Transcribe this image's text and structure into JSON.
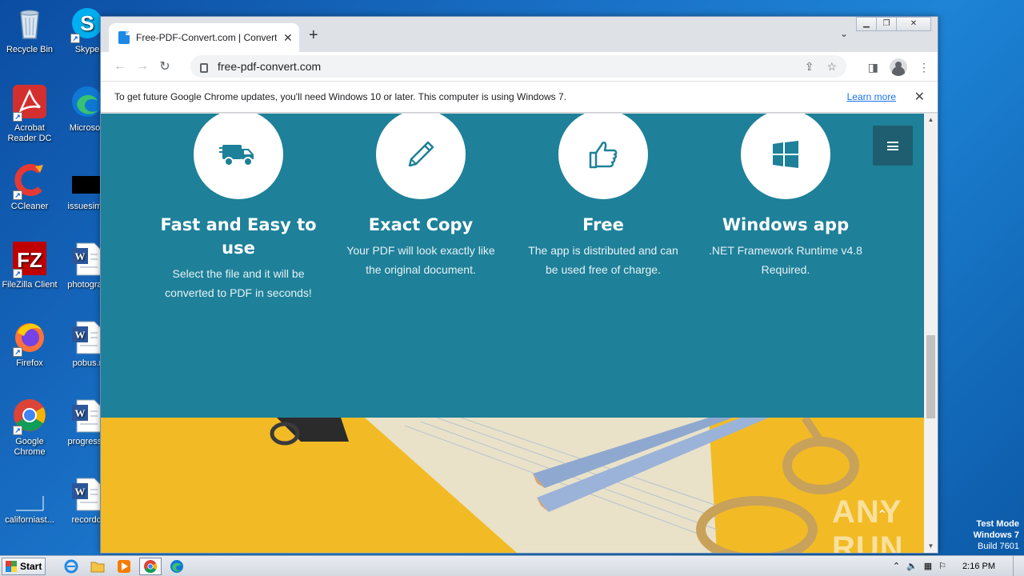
{
  "desktop": {
    "icons": [
      {
        "label": "Recycle Bin",
        "icon": "recycle-bin-icon"
      },
      {
        "label": "Skype",
        "icon": "skype-icon"
      },
      {
        "label": "Acrobat Reader DC",
        "icon": "acrobat-icon"
      },
      {
        "label": "Microsoft",
        "icon": "edge-icon"
      },
      {
        "label": "CCleaner",
        "icon": "ccleaner-icon"
      },
      {
        "label": "issuesimp",
        "icon": "file-icon"
      },
      {
        "label": "FileZilla Client",
        "icon": "filezilla-icon"
      },
      {
        "label": "photograp",
        "icon": "word-doc-icon"
      },
      {
        "label": "Firefox",
        "icon": "firefox-icon"
      },
      {
        "label": "pobus.r",
        "icon": "word-doc-icon"
      },
      {
        "label": "Google Chrome",
        "icon": "chrome-icon"
      },
      {
        "label": "progresso",
        "icon": "word-doc-icon"
      },
      {
        "label": "californiast...",
        "icon": "file-icon"
      },
      {
        "label": "recordcl",
        "icon": "word-doc-icon"
      }
    ],
    "test_mode": {
      "line1": "Test Mode",
      "line2": "Windows 7",
      "line3": "Build 7601"
    }
  },
  "browser": {
    "tab_title": "Free-PDF-Convert.com | Convert html",
    "url": "free-pdf-convert.com",
    "infobar": {
      "message": "To get future Google Chrome updates, you'll need Windows 10 or later. This computer is using Windows 7.",
      "link": "Learn more"
    }
  },
  "page": {
    "features": [
      {
        "icon": "truck-icon",
        "title": "Fast and Easy to use",
        "desc": "Select the file and it will be converted to PDF in seconds!"
      },
      {
        "icon": "pencil-icon",
        "title": "Exact Copy",
        "desc": "Your PDF will look exactly like the original document."
      },
      {
        "icon": "thumbs-up-icon",
        "title": "Free",
        "desc": "The app is distributed and can be used free of charge."
      },
      {
        "icon": "windows-icon",
        "title": "Windows app",
        "desc": ".NET Framework Runtime v4.8 Required."
      }
    ],
    "watermark": "ANY RUN",
    "colors": {
      "teal": "#1e8099",
      "menu": "#1f5e70",
      "photo_bg": "#f2bb25"
    }
  },
  "taskbar": {
    "start_label": "Start",
    "clock": "2:16 PM"
  }
}
